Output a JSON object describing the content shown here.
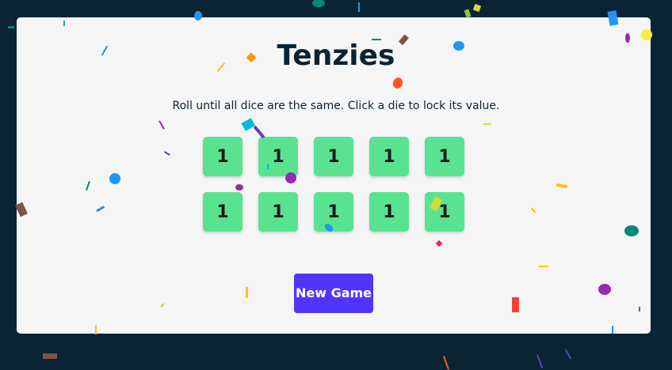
{
  "game": {
    "title": "Tenzies",
    "instructions": "Roll until all dice are the same. Click a die to lock its value.",
    "new_game_label": "New Game"
  },
  "dice": [
    {
      "value": "1",
      "held": false
    },
    {
      "value": "1",
      "held": false
    },
    {
      "value": "1",
      "held": false
    },
    {
      "value": "1",
      "held": false
    },
    {
      "value": "1",
      "held": false
    },
    {
      "value": "1",
      "held": false
    },
    {
      "value": "1",
      "held": false
    },
    {
      "value": "1",
      "held": false
    },
    {
      "value": "1",
      "held": false
    },
    {
      "value": "1",
      "held": false
    }
  ],
  "colors": {
    "background": "#0B2434",
    "card": "#F5F5F5",
    "die": "#59E391",
    "button": "#5035FF"
  }
}
